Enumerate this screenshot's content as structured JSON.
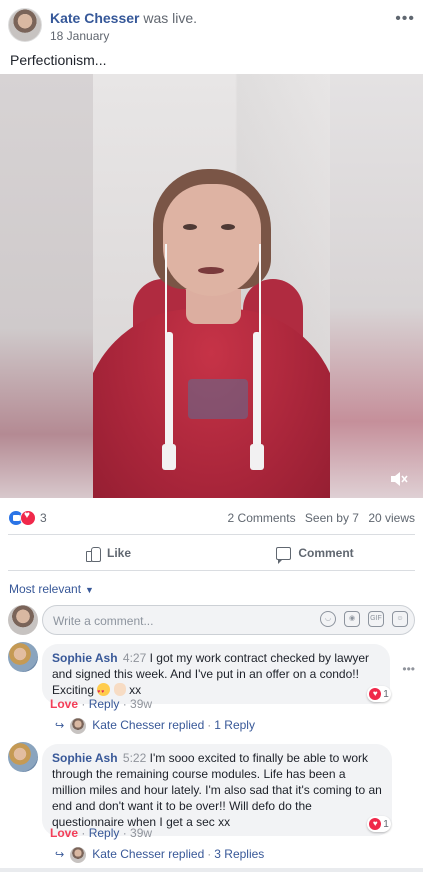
{
  "post": {
    "author": "Kate Chesser",
    "action": "was live.",
    "date": "18 January",
    "text": "Perfectionism..."
  },
  "stats": {
    "reaction_count": "3",
    "comments": "2 Comments",
    "seen_by": "Seen by 7",
    "views": "20 views"
  },
  "actions": {
    "like_label": "Like",
    "comment_label": "Comment"
  },
  "sort": {
    "label": "Most relevant"
  },
  "composer": {
    "placeholder": "Write a comment..."
  },
  "comments": [
    {
      "author": "Sophie Ash",
      "time": "4:27",
      "text_before_emoji": "I got my work contract checked by lawyer and signed this week. And I've put in an offer on a condo!! Exciting",
      "text_after_emoji": "xx",
      "love_label": "Love",
      "reply_label": "Reply",
      "age": "39w",
      "reaction_count": "1",
      "replied_by": "Kate Chesser replied",
      "replies": "1 Reply"
    },
    {
      "author": "Sophie Ash",
      "time": "5:22",
      "text": "I'm sooo excited to finally be able to work through the remaining course modules. Life has been a million miles and hour lately. I'm also sad that it's coming to an end and don't want it to be over!! Will defo do the questionnaire when I get a sec xx",
      "love_label": "Love",
      "reply_label": "Reply",
      "age": "39w",
      "reaction_count": "1",
      "replied_by": "Kate Chesser replied",
      "replies": "3 Replies"
    }
  ],
  "icons": {
    "more": "more-dots-icon",
    "mute": "speaker-muted-icon",
    "like": "thumbs-up-icon",
    "comment": "speech-bubble-icon",
    "emoji": "smiley-icon",
    "camera": "camera-icon",
    "gif": "gif-icon",
    "sticker": "sticker-icon"
  },
  "colors": {
    "link": "#385898",
    "name": "#365899",
    "love": "#f33e58",
    "like_badge": "#2b74e6",
    "muted_text": "#606770"
  }
}
